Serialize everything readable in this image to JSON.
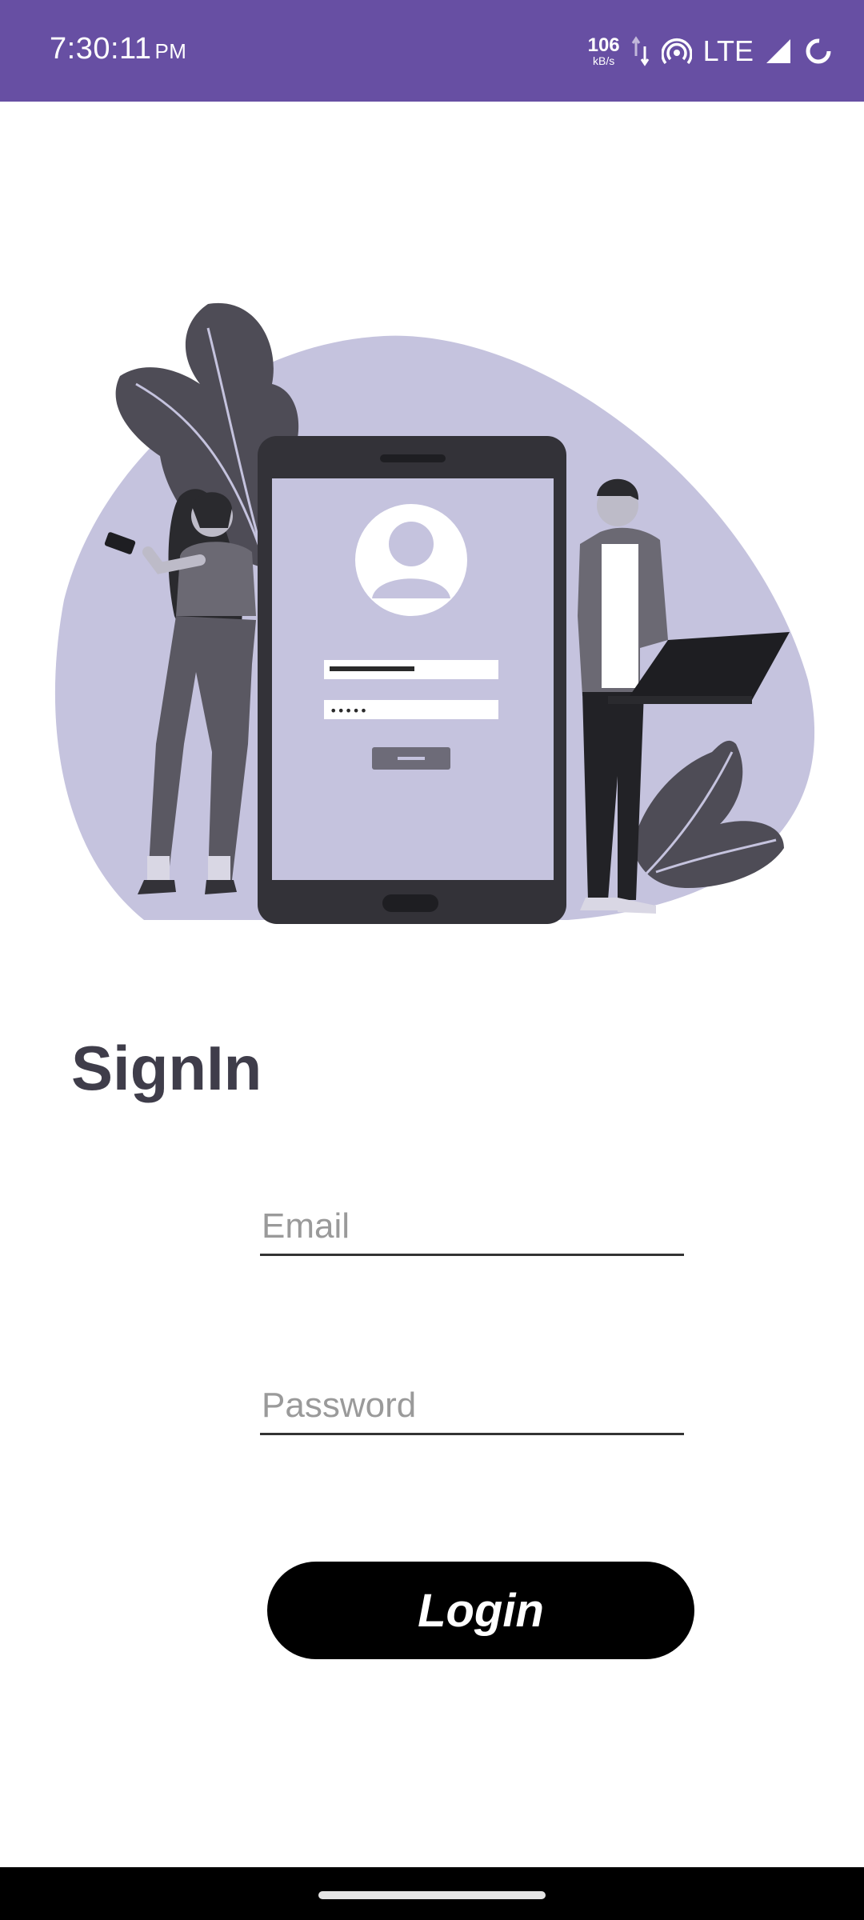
{
  "status_bar": {
    "time": "7:30:11",
    "ampm": "PM",
    "speed_value": "106",
    "speed_unit": "kB/s",
    "network": "LTE",
    "icons": [
      "data-transfer-icon",
      "hotspot-icon",
      "signal-icon",
      "battery-icon"
    ]
  },
  "illustration": {
    "icon": "login-illustration",
    "password_mask": "•••••"
  },
  "signin": {
    "title": "SignIn",
    "email_placeholder": "Email",
    "password_placeholder": "Password",
    "login_label": "Login"
  },
  "colors": {
    "status_bar": "#674fa3",
    "blob": "#c5c3de",
    "title": "#3f3d4a",
    "button": "#000000"
  }
}
